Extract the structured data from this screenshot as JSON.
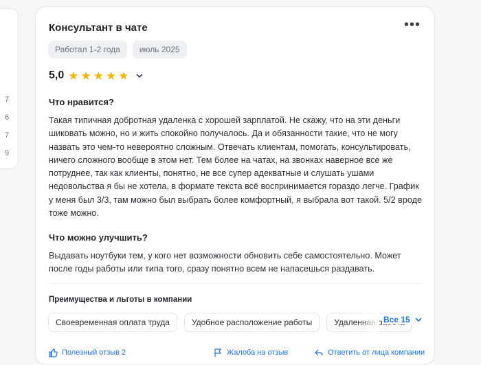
{
  "left_panel": {
    "numbers": [
      "7",
      "6",
      "7",
      "9"
    ]
  },
  "review": {
    "title": "Консультант в чате",
    "tags": [
      "Работал 1-2 года",
      "июль 2025"
    ],
    "rating_value": "5,0",
    "stars": 5,
    "likes_heading": "Что нравится?",
    "likes_text": "Такая типичная добротная удаленка с хорошей зарплатой. Не скажу, что на эти деньги шиковать можно, но и жить спокойно получалось. Да и обязанности такие, что не могу назвать это чем-то невероятно сложным. Отвечать клиентам, помогать, консультировать, ничего сложного вообще в этом нет. Тем более на чатах, на звонках наверное все же потруднее, так как клиенты, понятно, не все супер адекватные и слушать ушами недовольства я бы не хотела, в формате текста всё воспринимается гораздо легче. График у меня был 3/3, там можно был выбрать более комфортный, я выбрала вот такой. 5/2 вроде тоже можно.",
    "improve_heading": "Что можно улучшить?",
    "improve_text": "Выдавать ноутбуки тем, у кого нет возможности обновить себе самостоятельно. Может после годы работы или типа того, сразу понятно всем не напасешься раздавать.",
    "benefits_heading": "Преимущества и льготы в компании",
    "benefits": [
      "Своевременная оплата труда",
      "Удобное расположение работы",
      "Удаленная работа"
    ],
    "all_label": "Все 15",
    "footer": [
      "Полезный отзыв 2",
      "Жалоба на отзыв",
      "Ответить от лица компании"
    ]
  },
  "colors": {
    "accent": "#1a73e8",
    "star": "#f2b705"
  }
}
